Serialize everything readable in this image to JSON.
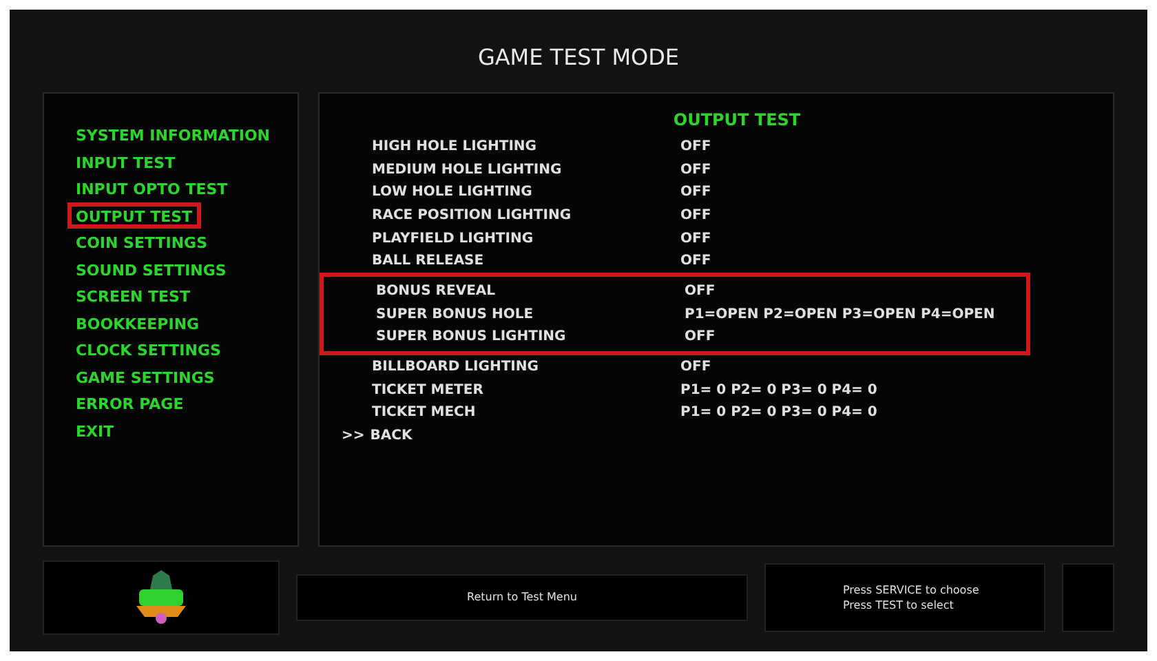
{
  "window": {
    "title": "GAME TEST MODE"
  },
  "menu": [
    {
      "label": "SYSTEM INFORMATION",
      "selected": false
    },
    {
      "label": "INPUT TEST",
      "selected": false
    },
    {
      "label": "INPUT OPTO TEST",
      "selected": false
    },
    {
      "label": "OUTPUT TEST",
      "selected": true
    },
    {
      "label": "COIN SETTINGS",
      "selected": false
    },
    {
      "label": "SOUND SETTINGS",
      "selected": false
    },
    {
      "label": "SCREEN TEST",
      "selected": false
    },
    {
      "label": "BOOKKEEPING",
      "selected": false
    },
    {
      "label": "CLOCK SETTINGS",
      "selected": false
    },
    {
      "label": "GAME SETTINGS",
      "selected": false
    },
    {
      "label": "ERROR PAGE",
      "selected": false
    },
    {
      "label": "EXIT",
      "selected": false
    }
  ],
  "panel": {
    "title": "OUTPUT TEST",
    "rows": [
      {
        "name": "HIGH HOLE LIGHTING",
        "value": "OFF",
        "highlighted": false
      },
      {
        "name": "MEDIUM HOLE LIGHTING",
        "value": "OFF",
        "highlighted": false
      },
      {
        "name": "LOW HOLE LIGHTING",
        "value": "OFF",
        "highlighted": false
      },
      {
        "name": "RACE POSITION LIGHTING",
        "value": "OFF",
        "highlighted": false
      },
      {
        "name": "PLAYFIELD LIGHTING",
        "value": "OFF",
        "highlighted": false
      },
      {
        "name": "BALL RELEASE",
        "value": "OFF",
        "highlighted": false
      },
      {
        "name": "BONUS REVEAL",
        "value": "OFF",
        "highlighted": true
      },
      {
        "name": "SUPER BONUS HOLE",
        "value": "P1=OPEN P2=OPEN P3=OPEN P4=OPEN",
        "highlighted": true
      },
      {
        "name": "SUPER BONUS LIGHTING",
        "value": "OFF",
        "highlighted": true
      },
      {
        "name": "BILLBOARD LIGHTING",
        "value": "OFF",
        "highlighted": false
      },
      {
        "name": "TICKET METER",
        "value": "P1= 0 P2= 0 P3= 0 P4= 0",
        "highlighted": false
      },
      {
        "name": "TICKET MECH",
        "value": "P1= 0 P2= 0 P3= 0 P4= 0",
        "highlighted": false
      }
    ],
    "back": {
      "arrow": ">>",
      "label": "BACK"
    }
  },
  "footer": {
    "return_label": "Return to Test Menu",
    "help": [
      "Press SERVICE to choose",
      "Press TEST to select"
    ]
  }
}
